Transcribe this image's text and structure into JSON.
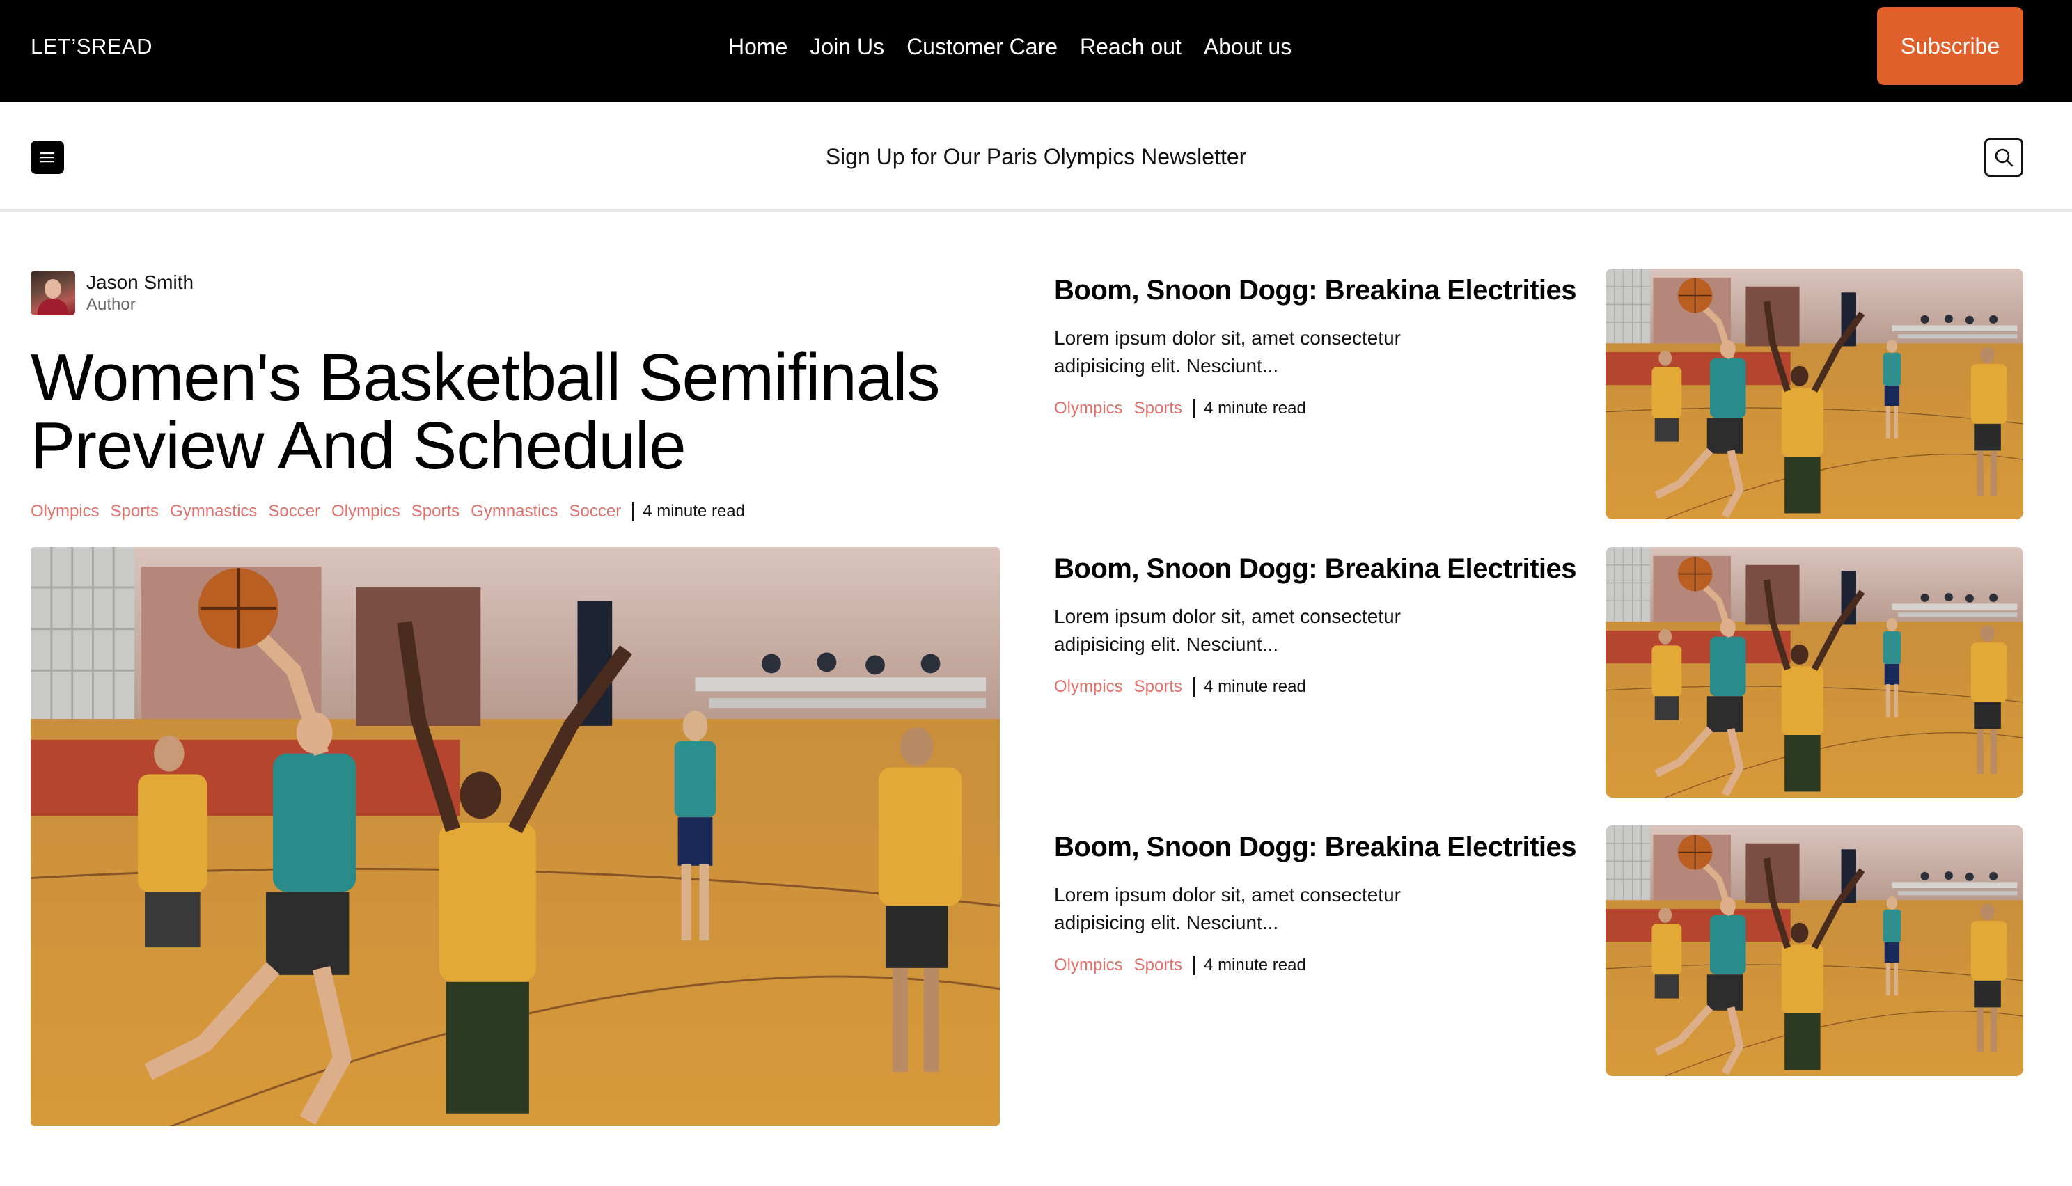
{
  "brand": "LET’SREAD",
  "nav": [
    "Home",
    "Join Us",
    "Customer Care",
    "Reach out",
    "About us"
  ],
  "subscribe_label": "Subscribe",
  "subheader": {
    "menu_icon": "hamburger-menu-icon",
    "newsletter_text": "Sign Up for Our Paris Olympics Newsletter",
    "search_icon": "search-icon"
  },
  "featured": {
    "author": {
      "name": "Jason Smith",
      "role": "Author"
    },
    "title": "Women's Basketball Semifinals Preview And Schedule",
    "tags": [
      "Olympics",
      "Sports",
      "Gymnastics",
      "Soccer",
      "Olympics",
      "Sports",
      "Gymnastics",
      "Soccer"
    ],
    "read_time": "4 minute read"
  },
  "articles": [
    {
      "title": "Boom, Snoon Dogg: Breakina Electrities",
      "excerpt": "Lorem ipsum dolor sit, amet consectetur adipisicing elit. Nesciunt...",
      "tags": [
        "Olympics",
        "Sports"
      ],
      "read_time": "4 minute read"
    },
    {
      "title": "Boom, Snoon Dogg: Breakina Electrities",
      "excerpt": "Lorem ipsum dolor sit, amet consectetur adipisicing elit. Nesciunt...",
      "tags": [
        "Olympics",
        "Sports"
      ],
      "read_time": "4 minute read"
    },
    {
      "title": "Boom, Snoon Dogg: Breakina Electrities",
      "excerpt": "Lorem ipsum dolor sit, amet consectetur adipisicing elit. Nesciunt...",
      "tags": [
        "Olympics",
        "Sports"
      ],
      "read_time": "4 minute read"
    }
  ],
  "colors": {
    "topbar": "#000000",
    "accent": "#e0602b",
    "tag": "#e2706a",
    "court": "#c98a2e"
  }
}
